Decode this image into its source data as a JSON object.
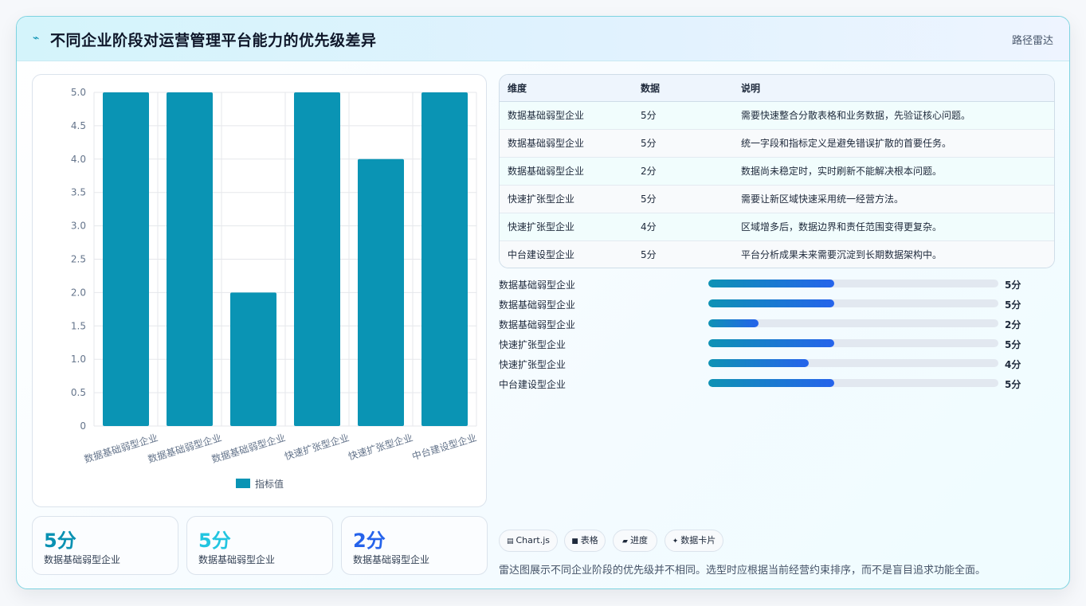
{
  "header": {
    "icon": "spark-icon",
    "title": "不同企业阶段对运营管理平台能力的优先级差异",
    "subtitle": "路径雷达"
  },
  "colors": {
    "bar": "#0a94b4",
    "accent_cyan": "#0891b2",
    "accent_light": "#22c5e0",
    "accent_blue": "#2563eb"
  },
  "chart_data": {
    "type": "bar",
    "categories": [
      "数据基础弱型企业",
      "数据基础弱型企业",
      "数据基础弱型企业",
      "快速扩张型企业",
      "快速扩张型企业",
      "中台建设型企业"
    ],
    "series": [
      {
        "name": "指标值",
        "values": [
          5,
          5,
          2,
          5,
          4,
          5
        ]
      }
    ],
    "ylim": [
      0,
      5
    ],
    "yticks": [
      "0",
      "0.5",
      "1.0",
      "1.5",
      "2.0",
      "2.5",
      "3.0",
      "3.5",
      "4.0",
      "4.5",
      "5.0"
    ],
    "grid": true,
    "legend": "bottom"
  },
  "kpis": [
    {
      "value": "5分",
      "label": "数据基础弱型企业",
      "color": "#0891b2"
    },
    {
      "value": "5分",
      "label": "数据基础弱型企业",
      "color": "#22c5e0"
    },
    {
      "value": "2分",
      "label": "数据基础弱型企业",
      "color": "#2563eb"
    }
  ],
  "table": {
    "headers": [
      "维度",
      "数据",
      "说明"
    ],
    "rows": [
      [
        "数据基础弱型企业",
        "5分",
        "需要快速整合分散表格和业务数据，先验证核心问题。"
      ],
      [
        "数据基础弱型企业",
        "5分",
        "统一字段和指标定义是避免错误扩散的首要任务。"
      ],
      [
        "数据基础弱型企业",
        "2分",
        "数据尚未稳定时，实时刷新不能解决根本问题。"
      ],
      [
        "快速扩张型企业",
        "5分",
        "需要让新区域快速采用统一经营方法。"
      ],
      [
        "快速扩张型企业",
        "4分",
        "区域增多后，数据边界和责任范围变得更复杂。"
      ],
      [
        "中台建设型企业",
        "5分",
        "平台分析成果未来需要沉淀到长期数据架构中。"
      ]
    ]
  },
  "progress": [
    {
      "label": "数据基础弱型企业",
      "value": "5分",
      "fraction": 0.433
    },
    {
      "label": "数据基础弱型企业",
      "value": "5分",
      "fraction": 0.433
    },
    {
      "label": "数据基础弱型企业",
      "value": "2分",
      "fraction": 0.173
    },
    {
      "label": "快速扩张型企业",
      "value": "5分",
      "fraction": 0.433
    },
    {
      "label": "快速扩张型企业",
      "value": "4分",
      "fraction": 0.346
    },
    {
      "label": "中台建设型企业",
      "value": "5分",
      "fraction": 0.433
    }
  ],
  "tags": [
    {
      "icon": "chart-icon",
      "glyph": "▤",
      "label": "Chart.js"
    },
    {
      "icon": "table-icon",
      "glyph": "■",
      "label": "表格"
    },
    {
      "icon": "progress-icon",
      "glyph": "▰",
      "label": "进度"
    },
    {
      "icon": "card-icon",
      "glyph": "✦",
      "label": "数据卡片"
    }
  ],
  "footnote": "雷达图展示不同企业阶段的优先级并不相同。选型时应根据当前经营约束排序，而不是盲目追求功能全面。"
}
